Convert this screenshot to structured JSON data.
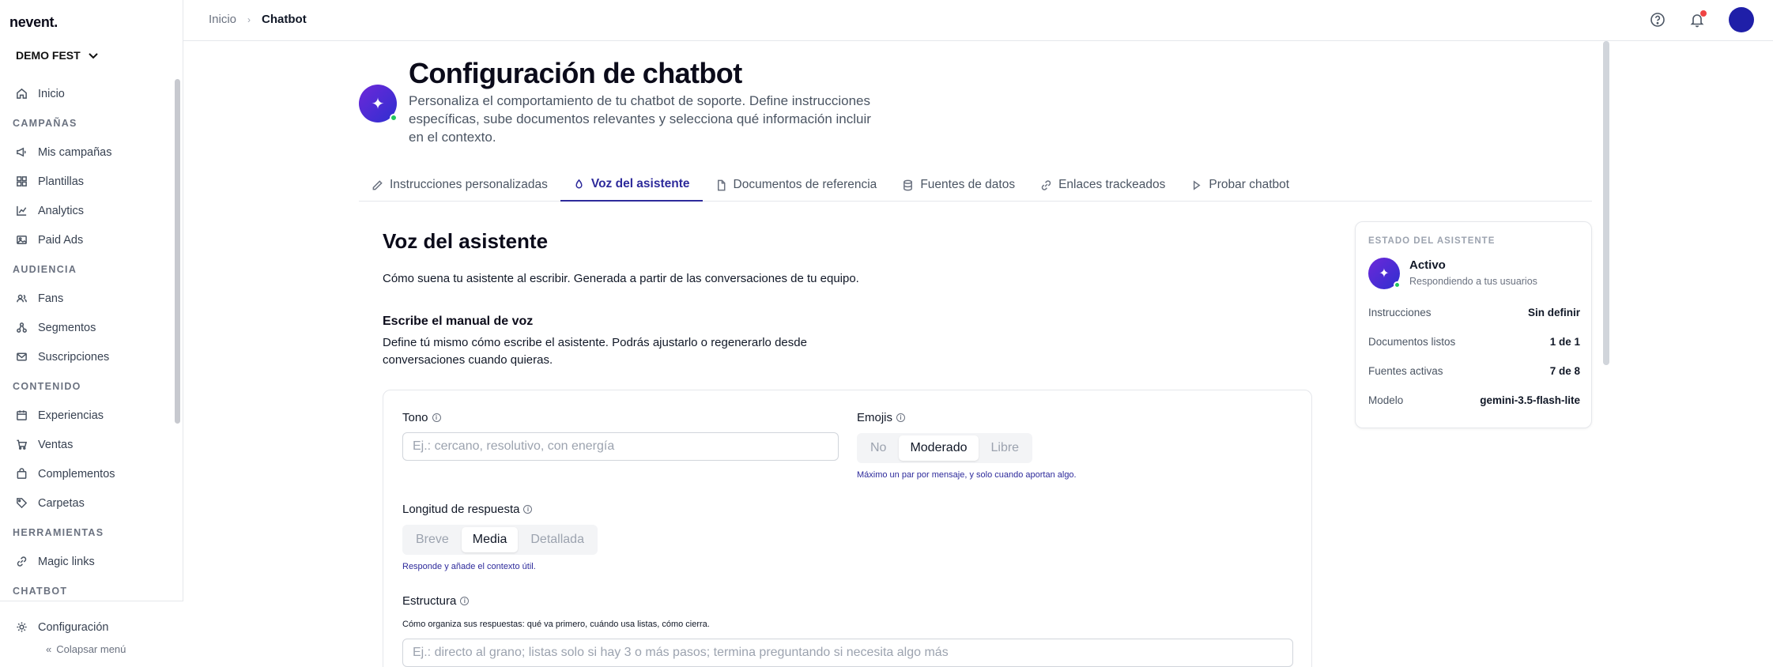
{
  "app": {
    "logo": "nevent.",
    "org": "DEMO FEST"
  },
  "sidebar": {
    "items": [
      {
        "type": "item",
        "label": "Inicio",
        "icon": "home-icon"
      },
      {
        "type": "section",
        "label": "CAMPAÑAS"
      },
      {
        "type": "item",
        "label": "Mis campañas",
        "icon": "megaphone-icon"
      },
      {
        "type": "item",
        "label": "Plantillas",
        "icon": "grid-icon"
      },
      {
        "type": "item",
        "label": "Analytics",
        "icon": "chart-icon"
      },
      {
        "type": "item",
        "label": "Paid Ads",
        "icon": "image-icon"
      },
      {
        "type": "section",
        "label": "AUDIENCIA"
      },
      {
        "type": "item",
        "label": "Fans",
        "icon": "users-icon"
      },
      {
        "type": "item",
        "label": "Segmentos",
        "icon": "segments-icon"
      },
      {
        "type": "item",
        "label": "Suscripciones",
        "icon": "mail-icon"
      },
      {
        "type": "section",
        "label": "CONTENIDO"
      },
      {
        "type": "item",
        "label": "Experiencias",
        "icon": "calendar-icon"
      },
      {
        "type": "item",
        "label": "Ventas",
        "icon": "cart-icon"
      },
      {
        "type": "item",
        "label": "Complementos",
        "icon": "bag-icon"
      },
      {
        "type": "item",
        "label": "Carpetas",
        "icon": "tag-icon"
      },
      {
        "type": "section",
        "label": "HERRAMIENTAS"
      },
      {
        "type": "item",
        "label": "Magic links",
        "icon": "link-icon"
      },
      {
        "type": "section",
        "label": "CHATBOT"
      }
    ],
    "settings_label": "Configuración",
    "collapse_label": "Colapsar menú"
  },
  "topbar": {
    "breadcrumb_home": "Inicio",
    "breadcrumb_current": "Chatbot",
    "icons": [
      "help-icon",
      "bell-icon",
      "avatar"
    ]
  },
  "header": {
    "title": "Configuración de chatbot",
    "subtitle": "Personaliza el comportamiento de tu chatbot de soporte. Define instrucciones específicas, sube documentos relevantes y selecciona qué información incluir en el contexto."
  },
  "tabs": [
    {
      "label": "Instrucciones personalizadas",
      "icon": "pencil-icon",
      "active": false
    },
    {
      "label": "Voz del asistente",
      "icon": "mic-icon",
      "active": true
    },
    {
      "label": "Documentos de referencia",
      "icon": "file-icon",
      "active": false
    },
    {
      "label": "Fuentes de datos",
      "icon": "database-icon",
      "active": false
    },
    {
      "label": "Enlaces trackeados",
      "icon": "link-icon",
      "active": false
    },
    {
      "label": "Probar chatbot",
      "icon": "play-icon",
      "active": false
    }
  ],
  "voice": {
    "title": "Voz del asistente",
    "description": "Cómo suena tu asistente al escribir. Generada a partir de las conversaciones de tu equipo.",
    "manual_title": "Escribe el manual de voz",
    "manual_description": "Define tú mismo cómo escribe el asistente. Podrás ajustarlo o regenerarlo desde conversaciones cuando quieras.",
    "tone": {
      "label": "Tono",
      "placeholder": "Ej.: cercano, resolutivo, con energía",
      "value": ""
    },
    "emojis": {
      "label": "Emojis",
      "options": [
        "No",
        "Moderado",
        "Libre"
      ],
      "selected": "Moderado",
      "hint": "Máximo un par por mensaje, y solo cuando aportan algo."
    },
    "length": {
      "label": "Longitud de respuesta",
      "options": [
        "Breve",
        "Media",
        "Detallada"
      ],
      "selected": "Media",
      "hint": "Responde y añade el contexto útil."
    },
    "structure": {
      "label": "Estructura",
      "hint": "Cómo organiza sus respuestas: qué va primero, cuándo usa listas, cómo cierra.",
      "placeholder": "Ej.: directo al grano; listas solo si hay 3 o más pasos; termina preguntando si necesita algo más",
      "value": ""
    }
  },
  "status": {
    "heading": "ESTADO DEL ASISTENTE",
    "name": "Activo",
    "subtitle": "Respondiendo a tus usuarios",
    "rows": [
      {
        "label": "Instrucciones",
        "value": "Sin definir"
      },
      {
        "label": "Documentos listos",
        "value": "1 de 1"
      },
      {
        "label": "Fuentes activas",
        "value": "7 de 8"
      },
      {
        "label": "Modelo",
        "value": "gemini-3.5-flash-lite"
      }
    ]
  },
  "colors": {
    "accent": "#2d2a9b",
    "status_online": "#22c55e",
    "notification": "#ef4444",
    "avatar": "#1f1fa8"
  }
}
